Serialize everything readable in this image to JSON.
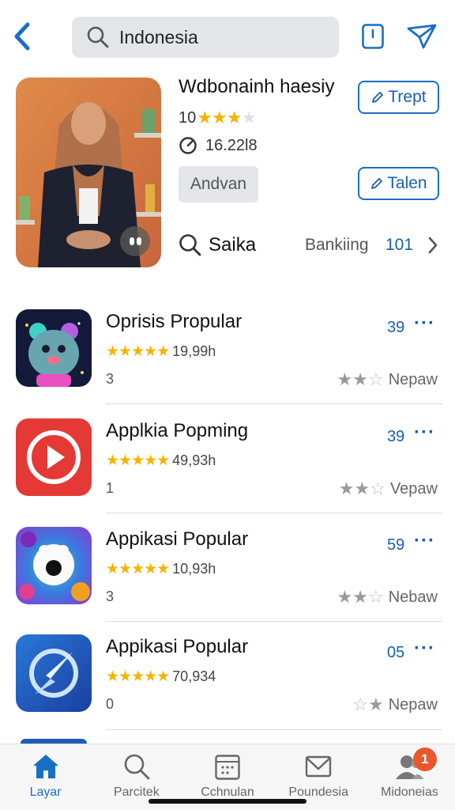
{
  "header": {
    "search_value": "Indonesia",
    "icons": [
      "back-arrow-icon",
      "search-icon",
      "clipboard-icon",
      "send-icon"
    ]
  },
  "featured": {
    "title": "Wdbonainh haesiy",
    "rating_number": "10",
    "rating_stars": 3,
    "stat": "16.22l8",
    "chip_label": "Andvan",
    "primary_button": "Trept",
    "secondary_button": "Talen",
    "search_label": "Saika",
    "category": "Bankiing",
    "count": "101"
  },
  "apps": [
    {
      "name": "Oprisis Propular",
      "downloads": "19,99h",
      "sub": "3",
      "score": "39",
      "meta": "Nepaw",
      "stars": 5,
      "icon": "bear-app-icon"
    },
    {
      "name": "Applkia Popming",
      "downloads": "49,93h",
      "sub": "1",
      "score": "39",
      "meta": "Vepaw",
      "stars": 5,
      "icon": "play-app-icon"
    },
    {
      "name": "Appikasi Popular",
      "downloads": "10,93h",
      "sub": "3",
      "score": "59",
      "meta": "Nebaw",
      "stars": 5,
      "icon": "panda-app-icon"
    },
    {
      "name": "Appikasi Popular",
      "downloads": "70,934",
      "sub": "0",
      "score": "05",
      "meta": "Nepaw",
      "stars": 5,
      "icon": "compass-app-icon"
    }
  ],
  "bottom_nav": [
    {
      "label": "Layar",
      "icon": "home-icon",
      "active": true
    },
    {
      "label": "Parcitek",
      "icon": "search-icon",
      "active": false
    },
    {
      "label": "Cchnulan",
      "icon": "calendar-icon",
      "active": false
    },
    {
      "label": "Poundesia",
      "icon": "mail-icon",
      "active": false
    },
    {
      "label": "Midoneias",
      "icon": "profile-icon",
      "active": false,
      "badge": "1"
    }
  ],
  "colors": {
    "accent": "#1a6fc4",
    "star": "#f5b301",
    "badge": "#e8582c"
  }
}
